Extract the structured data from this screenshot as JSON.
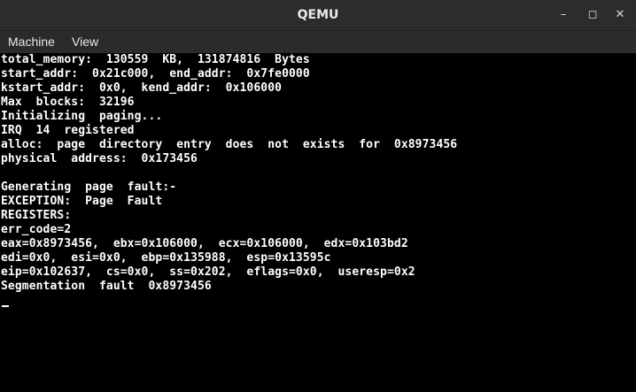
{
  "window": {
    "title": "QEMU",
    "controls": {
      "minimize": "–",
      "maximize": "◻",
      "close": "✕"
    }
  },
  "menubar": {
    "items": [
      "Machine",
      "View"
    ]
  },
  "console": {
    "lines": [
      "total_memory:  130559  KB,  131874816  Bytes",
      "start_addr:  0x21c000,  end_addr:  0x7fe0000",
      "kstart_addr:  0x0,  kend_addr:  0x106000",
      "Max  blocks:  32196",
      "Initializing  paging...",
      "IRQ  14  registered",
      "alloc:  page  directory  entry  does  not  exists  for  0x8973456",
      "physical  address:  0x173456",
      "",
      "Generating  page  fault:-",
      "EXCEPTION:  Page  Fault",
      "REGISTERS:",
      "err_code=2",
      "eax=0x8973456,  ebx=0x106000,  ecx=0x106000,  edx=0x103bd2",
      "edi=0x0,  esi=0x0,  ebp=0x135988,  esp=0x13595c",
      "eip=0x102637,  cs=0x0,  ss=0x202,  eflags=0x0,  useresp=0x2",
      "Segmentation  fault  0x8973456"
    ]
  }
}
